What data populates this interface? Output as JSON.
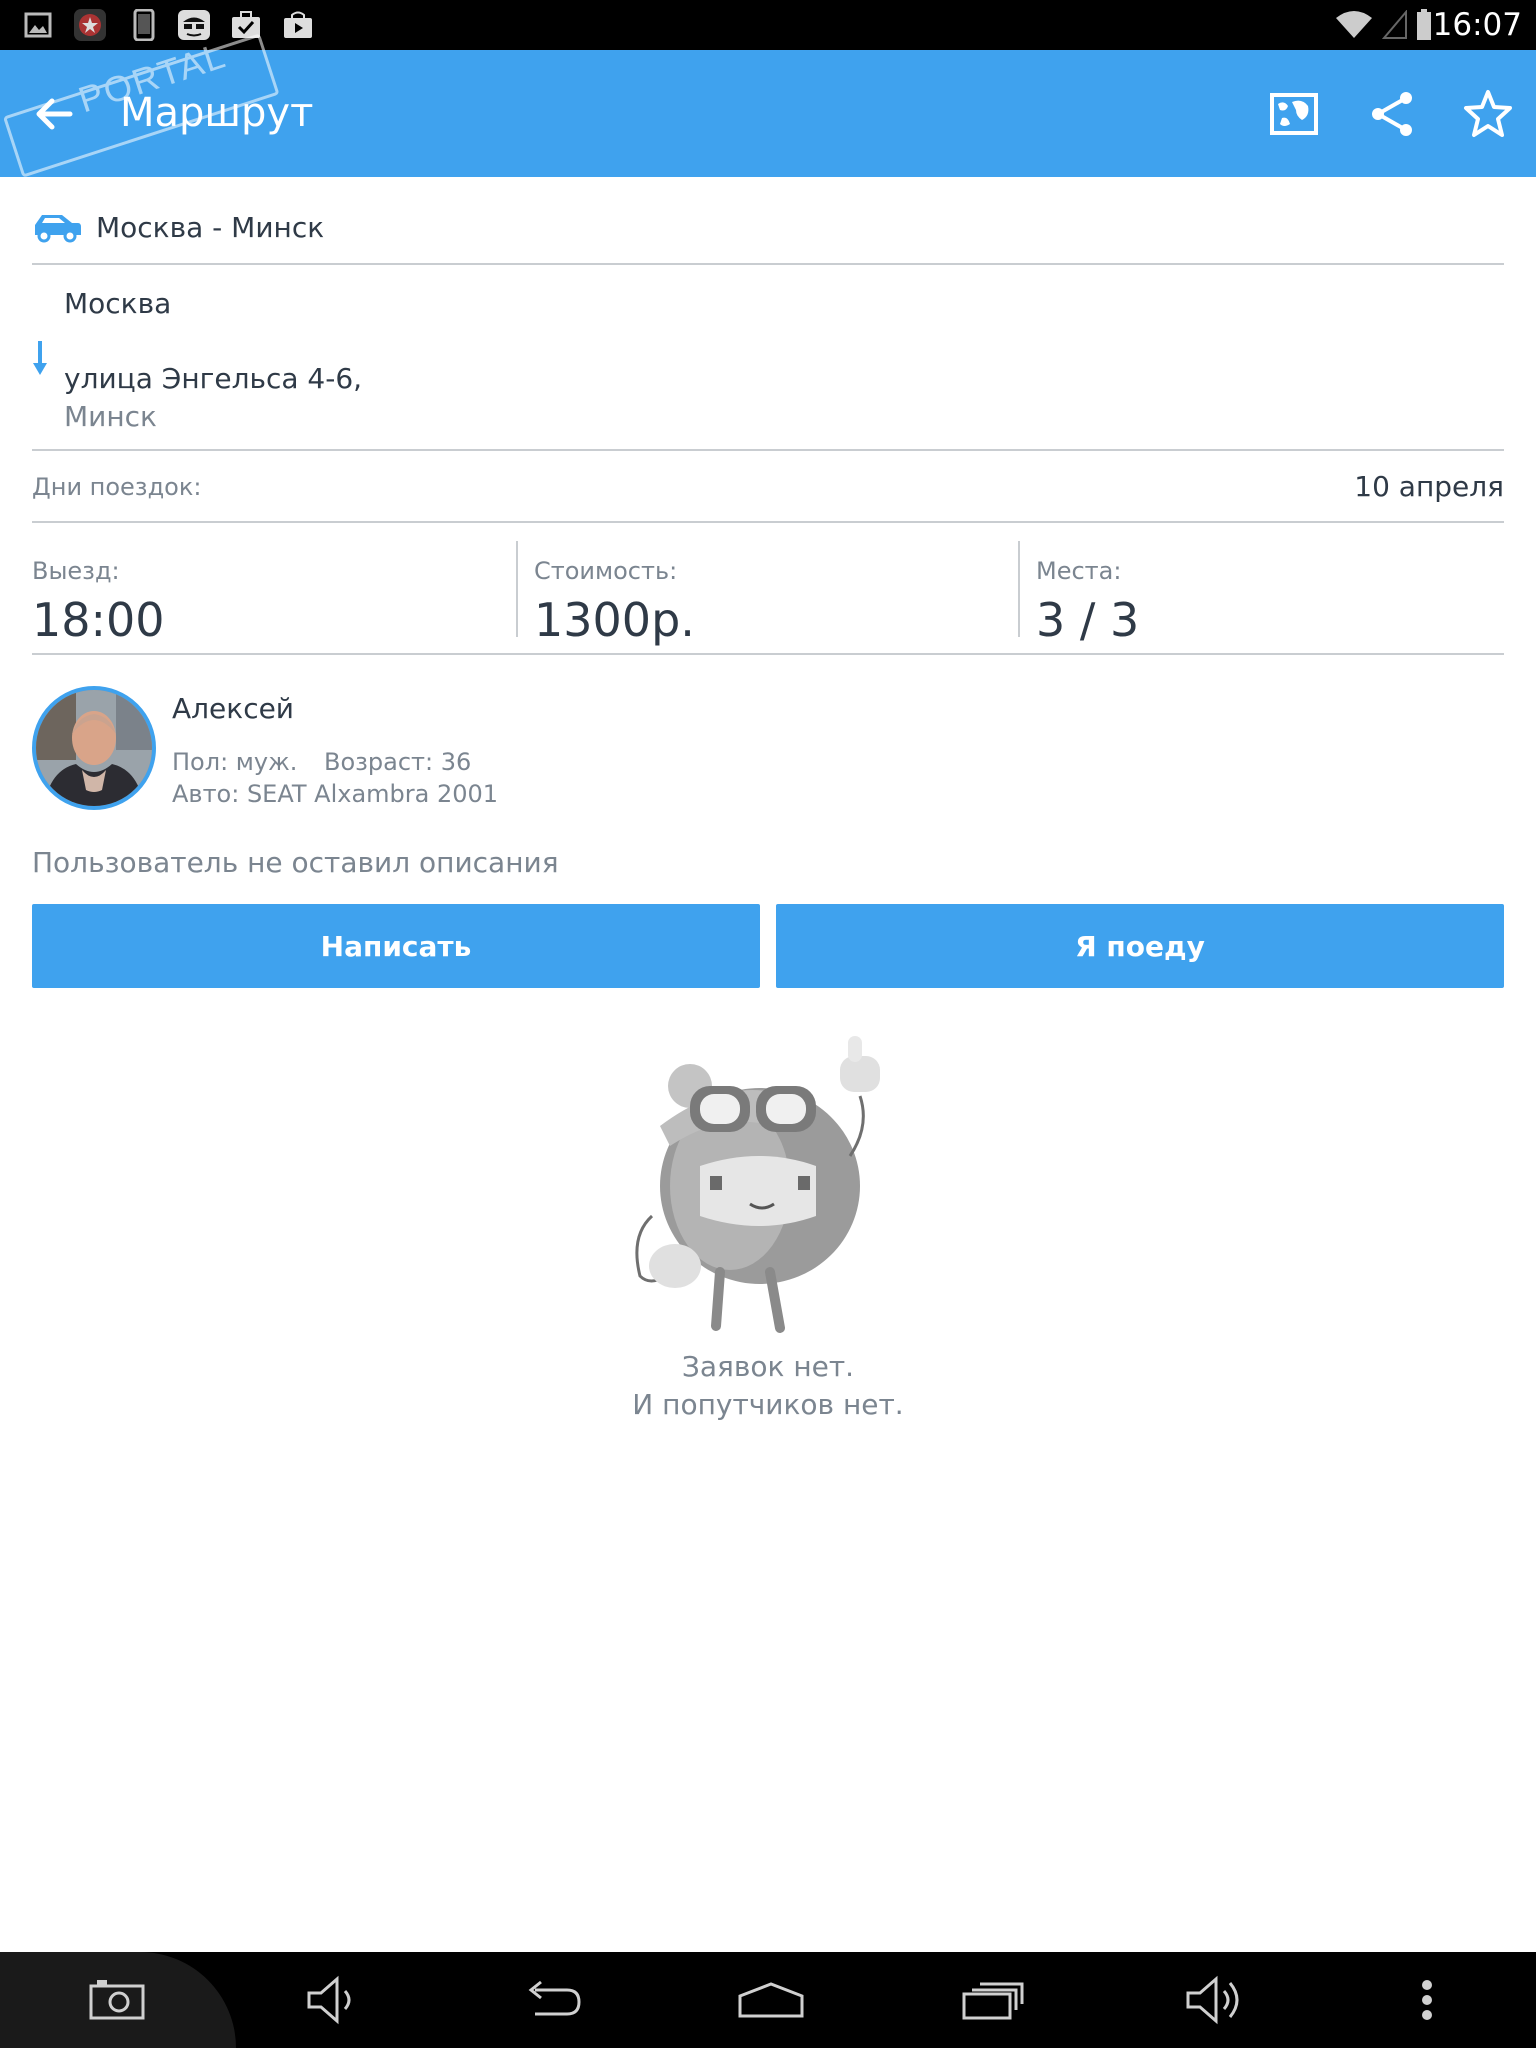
{
  "status_bar": {
    "time": "16:07",
    "notification_icons": [
      "gallery-icon",
      "app-badge-icon",
      "phone-icon",
      "spy-icon",
      "briefcase-check-icon",
      "shopping-bag-icon"
    ],
    "system_icons": [
      "wifi-icon",
      "signal-icon",
      "battery-icon"
    ]
  },
  "app_bar": {
    "title": "Маршрут",
    "back_icon": "arrow-left-icon",
    "actions": [
      "map-icon",
      "share-icon",
      "star-icon"
    ]
  },
  "watermark": {
    "text": "PORTAL"
  },
  "route": {
    "title": "Москва - Минск",
    "from": "Москва",
    "to_address": "улица Энгельса 4-6,",
    "to_city": "Минск"
  },
  "days": {
    "label": "Дни поездок:",
    "value": "10 апреля"
  },
  "stats": {
    "departure_label": "Выезд:",
    "departure_value": "18:00",
    "price_label": "Стоимость:",
    "price_value": "1300р.",
    "seats_label": "Места:",
    "seats_value": "3 / 3"
  },
  "driver": {
    "name": "Алексей",
    "gender": "Пол: муж.",
    "age": "Возраст: 36",
    "car": "Авто: SEAT Alxambra 2001",
    "description": "Пользователь не оставил описания"
  },
  "buttons": {
    "write": "Написать",
    "join": "Я поеду"
  },
  "empty_state": {
    "line1": "Заявок нет.",
    "line2": "И попутчиков нет."
  },
  "nav_bar": {
    "icons": [
      "screenshot-icon",
      "volume-down-icon",
      "back-icon",
      "home-icon",
      "recents-icon",
      "volume-up-icon",
      "overflow-menu-icon"
    ]
  },
  "colors": {
    "accent": "#3fa2ee",
    "text": "#2f3a47",
    "muted": "#7b8590",
    "divider": "#c9cdd1"
  }
}
